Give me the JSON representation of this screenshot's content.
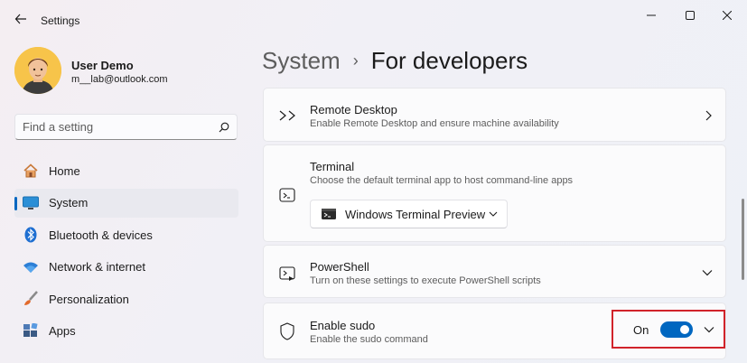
{
  "window": {
    "title": "Settings"
  },
  "user": {
    "name": "User Demo",
    "email": "m__lab@outlook.com"
  },
  "search": {
    "placeholder": "Find a setting"
  },
  "sidebar": {
    "items": [
      {
        "label": "Home",
        "icon": "home-icon"
      },
      {
        "label": "System",
        "icon": "system-icon",
        "active": true
      },
      {
        "label": "Bluetooth & devices",
        "icon": "bluetooth-icon"
      },
      {
        "label": "Network & internet",
        "icon": "wifi-icon"
      },
      {
        "label": "Personalization",
        "icon": "brush-icon"
      },
      {
        "label": "Apps",
        "icon": "apps-icon"
      }
    ]
  },
  "breadcrumb": {
    "parent": "System",
    "separator": "›",
    "current": "For developers"
  },
  "cards": {
    "remote_desktop": {
      "title": "Remote Desktop",
      "desc": "Enable Remote Desktop and ensure machine availability"
    },
    "terminal": {
      "title": "Terminal",
      "desc": "Choose the default terminal app to host command-line apps",
      "selected": "Windows Terminal Preview"
    },
    "powershell": {
      "title": "PowerShell",
      "desc": "Turn on these settings to execute PowerShell scripts"
    },
    "sudo": {
      "title": "Enable sudo",
      "desc": "Enable the sudo command",
      "state": "On",
      "enabled": true
    }
  },
  "colors": {
    "accent": "#0067c0",
    "highlight": "#d1232a"
  }
}
